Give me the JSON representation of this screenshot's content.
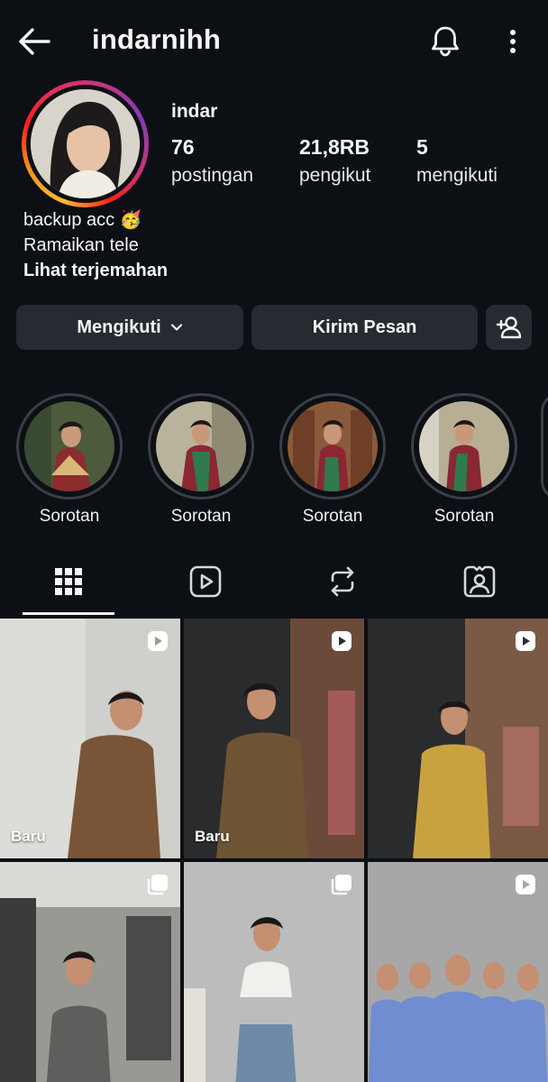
{
  "header": {
    "username": "indarnihh",
    "icons": [
      "back-arrow-icon",
      "bell-icon",
      "more-vertical-icon"
    ]
  },
  "profile": {
    "display_name": "indar",
    "stats": [
      {
        "value": "76",
        "label": "postingan"
      },
      {
        "value": "21,8RB",
        "label": "pengikut"
      },
      {
        "value": "5",
        "label": "mengikuti"
      }
    ],
    "bio_lines": [
      "backup acc 🥳",
      "Ramaikan tele"
    ],
    "translate_link": "Lihat terjemahan"
  },
  "actions": {
    "following_label": "Mengikuti",
    "message_label": "Kirim Pesan",
    "suggest_icon": "add-person-icon"
  },
  "highlights": [
    {
      "label": "Sorotan"
    },
    {
      "label": "Sorotan"
    },
    {
      "label": "Sorotan"
    },
    {
      "label": "Sorotan"
    }
  ],
  "tabs": [
    "grid-icon",
    "reels-icon",
    "reposts-icon",
    "tagged-icon"
  ],
  "posts": [
    {
      "badge": "Baru",
      "type": "reel"
    },
    {
      "badge": "Baru",
      "type": "reel"
    },
    {
      "badge": "",
      "type": "reel"
    },
    {
      "badge": "",
      "type": "carousel"
    },
    {
      "badge": "",
      "type": "carousel"
    },
    {
      "badge": "",
      "type": "reel"
    }
  ],
  "colors": {
    "background": "#0c0f14",
    "button": "#262a31",
    "text": "#f5f5f5"
  }
}
